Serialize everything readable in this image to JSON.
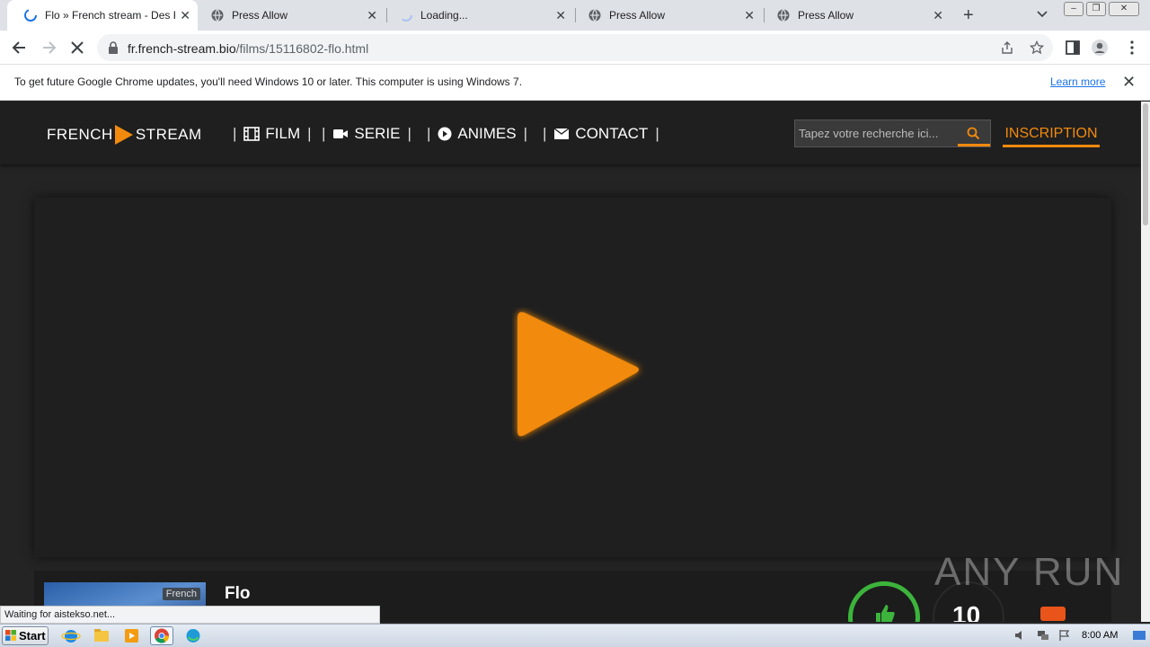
{
  "browser": {
    "tabs": [
      {
        "title": "Flo » French stream - Des Films",
        "active": true,
        "icon": "loading-spinner-icon"
      },
      {
        "title": "Press Allow",
        "active": false,
        "icon": "globe-icon"
      },
      {
        "title": "Loading...",
        "active": false,
        "icon": "loading-spinner-icon"
      },
      {
        "title": "Press Allow",
        "active": false,
        "icon": "globe-icon"
      },
      {
        "title": "Press Allow",
        "active": false,
        "icon": "globe-icon"
      }
    ],
    "url_host": "fr.french-stream.bio",
    "url_path": "/films/15116802-flo.html",
    "infobar_message": "To get future Google Chrome updates, you'll need Windows 10 or later. This computer is using Windows 7.",
    "infobar_link": "Learn more",
    "status_text": "Waiting for aistekso.net..."
  },
  "site": {
    "logo_left": "FRENCH",
    "logo_right": "STREAM",
    "nav": {
      "film": "FILM",
      "serie": "SERIE",
      "animes": "ANIMES",
      "contact": "CONTACT"
    },
    "search_placeholder": "Tapez votre recherche ici...",
    "signup": "INSCRIPTION",
    "movie_title": "Flo",
    "language_badge": "French",
    "score": "10",
    "accent_color": "#f28a0e",
    "like_color": "#3cb43c"
  },
  "watermark": "ANY RUN",
  "taskbar": {
    "start_label": "Start",
    "clock": "8:00 AM"
  }
}
